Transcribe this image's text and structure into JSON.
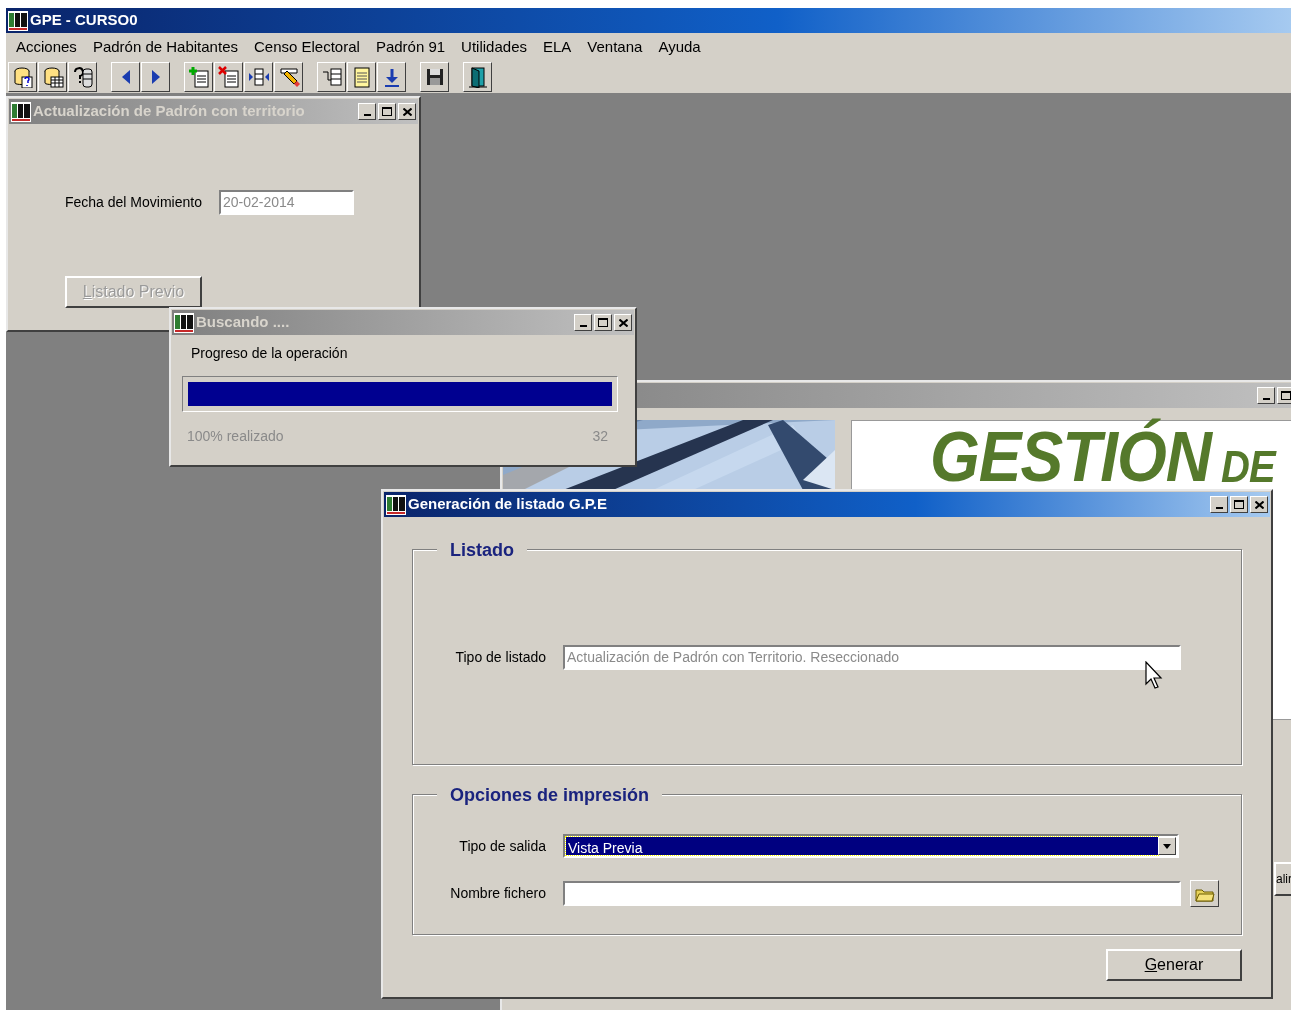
{
  "app": {
    "title": "GPE - CURSO0"
  },
  "menu": [
    "Acciones",
    "Padrón de Habitantes",
    "Censo Electoral",
    "Padrón 91",
    "Utilidades",
    "ELA",
    "Ventana",
    "Ayuda"
  ],
  "form_window": {
    "title": "Actualización de Padrón con territorio",
    "active": false,
    "date_label": "Fecha del Movimiento",
    "date_value": "20-02-2014",
    "date_disabled": true,
    "button": {
      "label": "Listado Previo",
      "disabled": true
    }
  },
  "progress_window": {
    "title": "Buscando ....",
    "active": false,
    "caption": "Progreso de la operación",
    "level": 1,
    "status": "100% realizado",
    "count": "32"
  },
  "background_window": {
    "active": false,
    "logo": [
      "GESTIÓN",
      "DE"
    ],
    "button_fragment": "alir"
  },
  "dialog": {
    "title": "Generación de listado G.P.E",
    "active": true,
    "sections": [
      {
        "legend": "Listado",
        "fields": [
          {
            "kind": "text",
            "label": "Tipo de listado",
            "value": "Actualización de Padrón con Territorio. Reseccionado",
            "disabled": true
          }
        ]
      },
      {
        "legend": "Opciones de impresión",
        "fields": [
          {
            "kind": "select",
            "label": "Tipo de salida",
            "value": "Vista Previa",
            "selected": true
          },
          {
            "kind": "file",
            "label": "Nombre fichero"
          }
        ]
      }
    ],
    "button": "Generar"
  }
}
